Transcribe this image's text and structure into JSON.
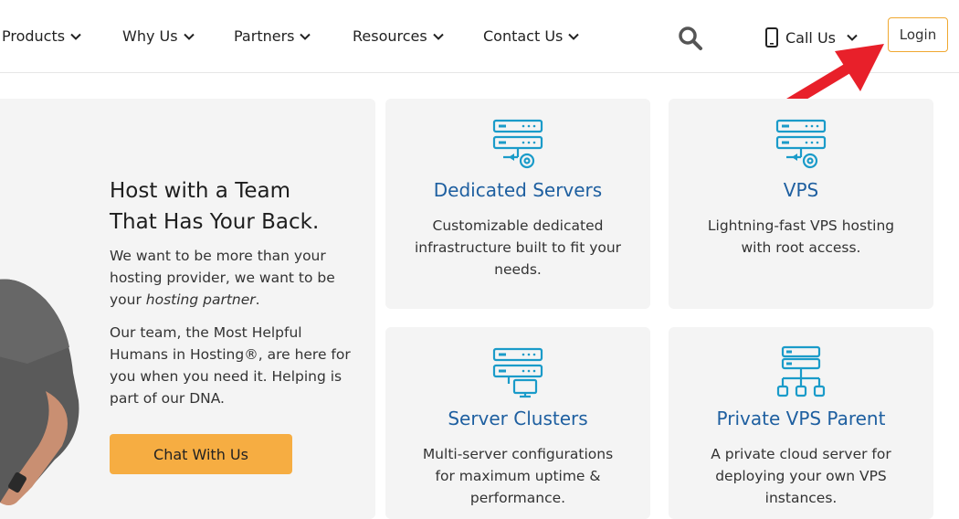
{
  "nav": {
    "items": [
      {
        "label": "Products"
      },
      {
        "label": "Why Us"
      },
      {
        "label": "Partners"
      },
      {
        "label": "Resources"
      },
      {
        "label": "Contact Us"
      }
    ],
    "call_label": "Call Us",
    "login_label": "Login"
  },
  "hero": {
    "title_line1": "Host with a Team",
    "title_line2": "That Has Your Back.",
    "p1_before": "We want to be more than your hosting provider, we want to be your ",
    "p1_italic": "hosting partner",
    "p1_after": ".",
    "p2": "Our team, the Most Helpful Humans in Hosting®, are here for you when you need it. Helping is part of our DNA.",
    "chat_label": "Chat With Us"
  },
  "cards": [
    {
      "title": "Dedicated Servers",
      "desc": "Customizable dedicated infrastructure built to fit your needs.",
      "icon": "server-gear-icon"
    },
    {
      "title": "VPS",
      "desc": "Lightning-fast VPS hosting with root access.",
      "icon": "server-gear-icon"
    },
    {
      "title": "Server Clusters",
      "desc": "Multi-server configurations for maximum uptime & performance.",
      "icon": "server-monitor-icon"
    },
    {
      "title": "Private VPS Parent",
      "desc": "A private cloud server for deploying your own VPS instances.",
      "icon": "server-network-icon"
    }
  ],
  "colors": {
    "accent_orange": "#f6ad42",
    "title_blue": "#1e5fa0",
    "icon_teal": "#1a9bc9",
    "annotation_red": "#e8202a"
  }
}
